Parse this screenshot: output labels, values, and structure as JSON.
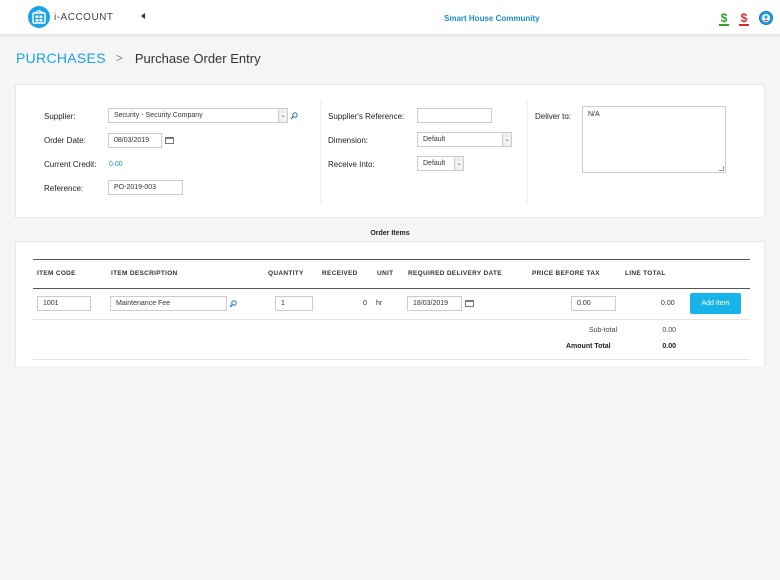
{
  "header": {
    "app_name": "i-ACCOUNT",
    "community": "Smart House Community",
    "icons": [
      "logo-icon",
      "collapse-caret-icon",
      "dollar-in-icon",
      "dollar-out-icon",
      "user-avatar-icon"
    ],
    "colors": {
      "accent": "#1aa3e8",
      "green": "#2aa52a",
      "red": "#d92b2b"
    }
  },
  "breadcrumb": {
    "root": "PURCHASES",
    "separator": ">",
    "current": "Purchase Order Entry"
  },
  "form": {
    "supplier_label": "Supplier:",
    "supplier_value": "Security - Security Company",
    "order_date_label": "Order Date:",
    "order_date_value": "08/03/2019",
    "current_credit_label": "Current Credit:",
    "current_credit_value": "0.00",
    "reference_label": "Reference:",
    "reference_value": "PO-2019-003",
    "supplier_ref_label": "Supplier's Reference:",
    "supplier_ref_value": "",
    "dimension_label": "Dimension:",
    "dimension_value": "Default",
    "receive_into_label": "Receive Into:",
    "receive_into_value": "Default",
    "deliver_to_label": "Deliver to:",
    "deliver_to_value": "N/A"
  },
  "items": {
    "section_title": "Order Items",
    "columns": [
      "ITEM CODE",
      "ITEM DESCRIPTION",
      "QUANTITY",
      "RECEIVED",
      "UNIT",
      "REQUIRED DELIVERY DATE",
      "PRICE BEFORE TAX",
      "LINE TOTAL"
    ],
    "row": {
      "item_code": "1001",
      "description": "Maintenance Fee",
      "quantity": "1",
      "received": "0",
      "unit": "hr",
      "delivery_date": "18/03/2019",
      "price": "0.00",
      "line_total": "0.00"
    },
    "add_button": "Add Item",
    "subtotal_label": "Sub-total",
    "subtotal_value": "0.00",
    "amount_total_label": "Amount Total",
    "amount_total_value": "0.00"
  }
}
